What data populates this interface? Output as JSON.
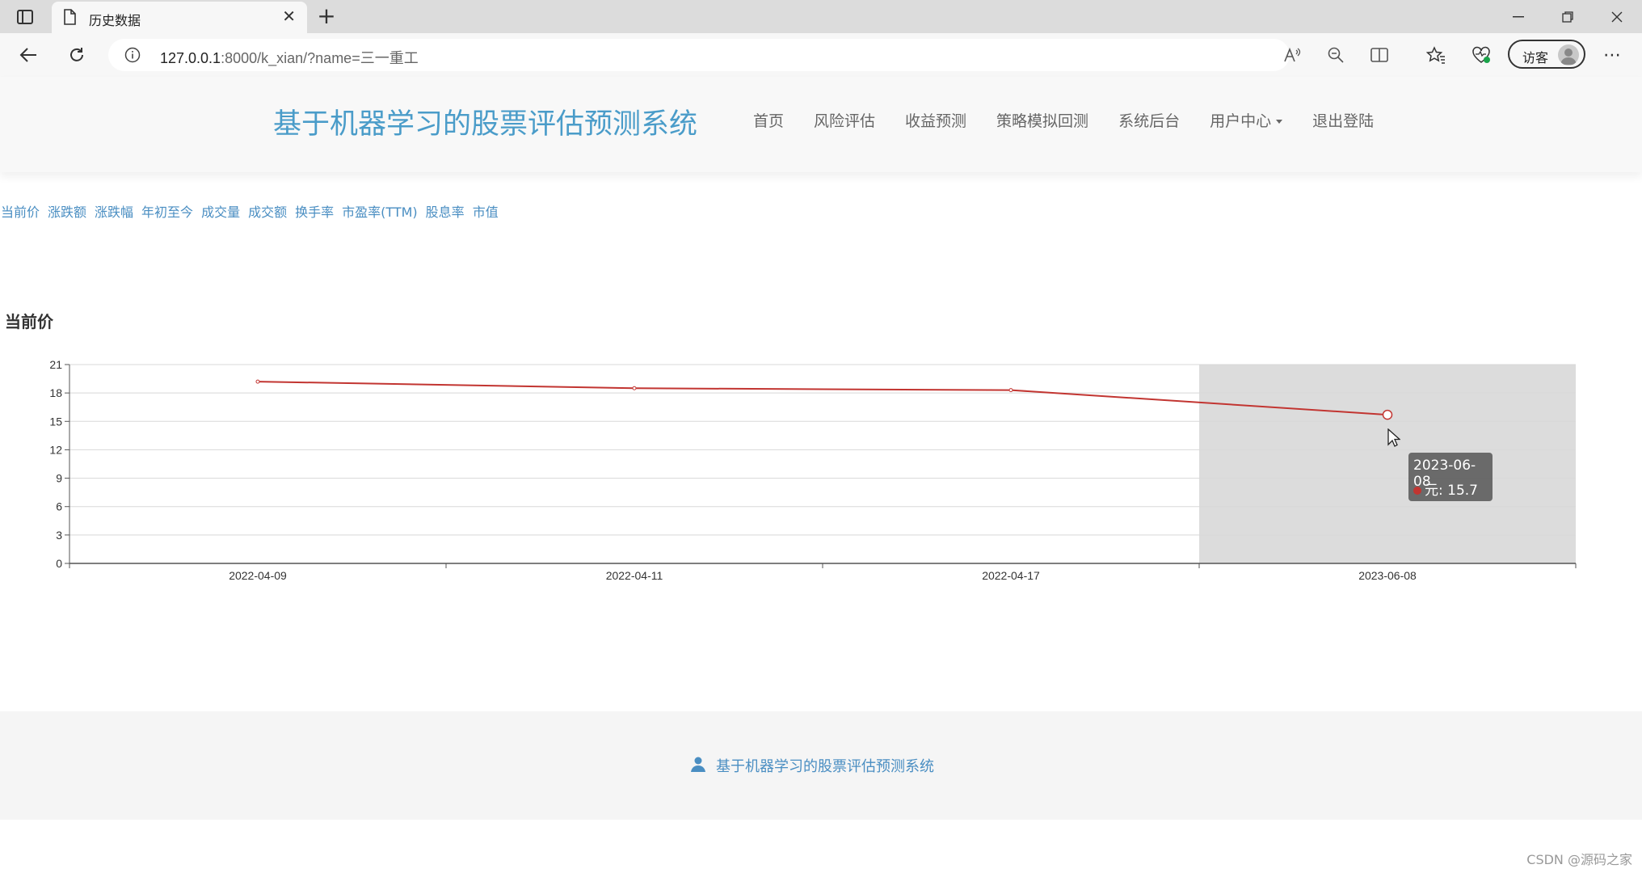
{
  "browser": {
    "tab_title": "历史数据",
    "tab_close": "✕",
    "new_tab": "+",
    "url_host": "127.0.0.1",
    "url_rest": ":8000/k_xian/?name=三一重工",
    "guest_label": "访客",
    "more": "⋯"
  },
  "header": {
    "brand": "基于机器学习的股票评估预测系统",
    "nav": [
      "首页",
      "风险评估",
      "收益预测",
      "策略模拟回测",
      "系统后台",
      "用户中心",
      "退出登陆"
    ]
  },
  "metrics": [
    "当前价",
    "涨跌额",
    "涨跌幅",
    "年初至今",
    "成交量",
    "成交额",
    "换手率",
    "市盈率(TTM)",
    "股息率",
    "市值"
  ],
  "chart_title": "当前价",
  "chart_data": {
    "type": "line",
    "title": "当前价",
    "categories": [
      "2022-04-09",
      "2022-04-11",
      "2022-04-17",
      "2023-06-08"
    ],
    "series": [
      {
        "name": "元",
        "values": [
          19.2,
          18.5,
          18.3,
          15.7
        ]
      }
    ],
    "ylim": [
      0,
      21
    ],
    "yticks": [
      0,
      3,
      6,
      9,
      12,
      15,
      18,
      21
    ],
    "grid": true,
    "color": "#c23531",
    "highlight_index": 3
  },
  "tooltip": {
    "date": "2023-06-08",
    "label": "元: 15.7"
  },
  "footer": {
    "text": "基于机器学习的股票评估预测系统"
  },
  "watermark": "CSDN @源码之家"
}
